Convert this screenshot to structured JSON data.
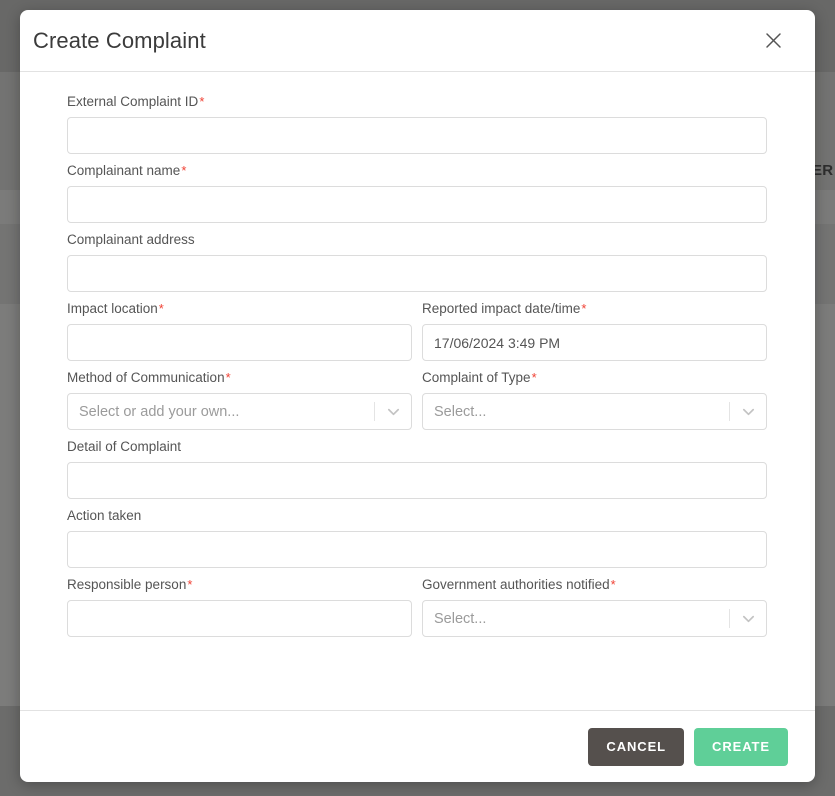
{
  "backdrop": {
    "partial_text": "ER"
  },
  "modal": {
    "title": "Create Complaint",
    "close_icon": "close-icon",
    "fields": [
      {
        "key": "external_complaint_id",
        "label": "External Complaint ID",
        "required": true,
        "type": "text",
        "value": "",
        "placeholder": ""
      },
      {
        "key": "complainant_name",
        "label": "Complainant name",
        "required": true,
        "type": "text",
        "value": "",
        "placeholder": ""
      },
      {
        "key": "complainant_address",
        "label": "Complainant address",
        "required": false,
        "type": "text",
        "value": "",
        "placeholder": ""
      },
      {
        "key": "impact_location",
        "label": "Impact location",
        "required": true,
        "type": "text",
        "value": "",
        "placeholder": ""
      },
      {
        "key": "reported_impact_datetime",
        "label": "Reported impact date/time",
        "required": true,
        "type": "text",
        "value": "17/06/2024 3:49 PM",
        "placeholder": ""
      },
      {
        "key": "method_of_communication",
        "label": "Method of Communication",
        "required": true,
        "type": "select",
        "value": "Select or add your own...",
        "icon": "chevron-down-icon"
      },
      {
        "key": "complaint_of_type",
        "label": "Complaint of Type",
        "required": true,
        "type": "select",
        "value": "Select...",
        "icon": "chevron-down-icon"
      },
      {
        "key": "detail_of_complaint",
        "label": "Detail of Complaint",
        "required": false,
        "type": "text",
        "value": "",
        "placeholder": ""
      },
      {
        "key": "action_taken",
        "label": "Action taken",
        "required": false,
        "type": "text",
        "value": "",
        "placeholder": ""
      },
      {
        "key": "responsible_person",
        "label": "Responsible person",
        "required": true,
        "type": "text",
        "value": "",
        "placeholder": ""
      },
      {
        "key": "government_authorities_notified",
        "label": "Government authorities notified",
        "required": true,
        "type": "select",
        "value": "Select...",
        "icon": "chevron-down-icon"
      }
    ],
    "footer": {
      "cancel_label": "CANCEL",
      "create_label": "CREATE",
      "cancel_color": "#55504d",
      "create_color": "#5fcf98"
    },
    "required_marker": "*",
    "required_color": "#f04134"
  }
}
